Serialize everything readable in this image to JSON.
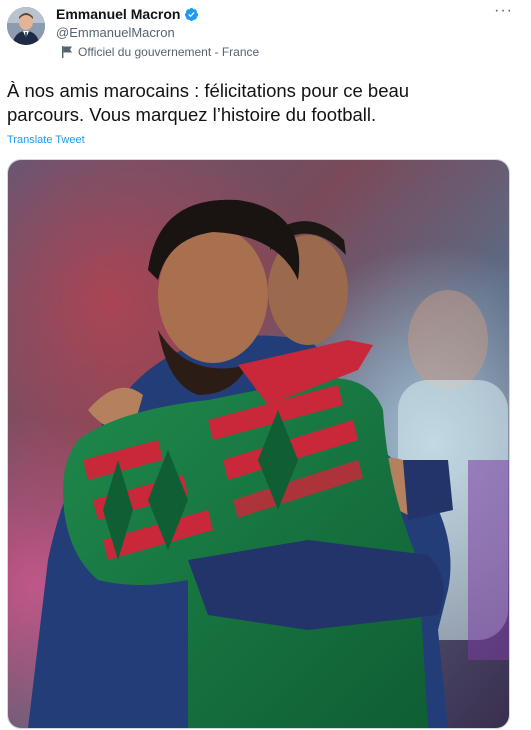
{
  "author": {
    "display_name": "Emmanuel Macron",
    "handle": "@EmmanuelMacron",
    "label": "Officiel du gouvernement - France"
  },
  "tweet": {
    "line1": "À nos amis marocains : félicitations pour ce beau",
    "line2": "parcours. Vous marquez l’histoire du football.",
    "translate_label": "Translate Tweet",
    "more_label": "···"
  },
  "colors": {
    "verified": "#1d9bf0",
    "link": "#1d9bf0",
    "text": "#0f1419",
    "muted": "#536471"
  },
  "icons": {
    "verified": "verified-badge-icon",
    "label": "flag-icon",
    "more": "more-options-icon"
  }
}
